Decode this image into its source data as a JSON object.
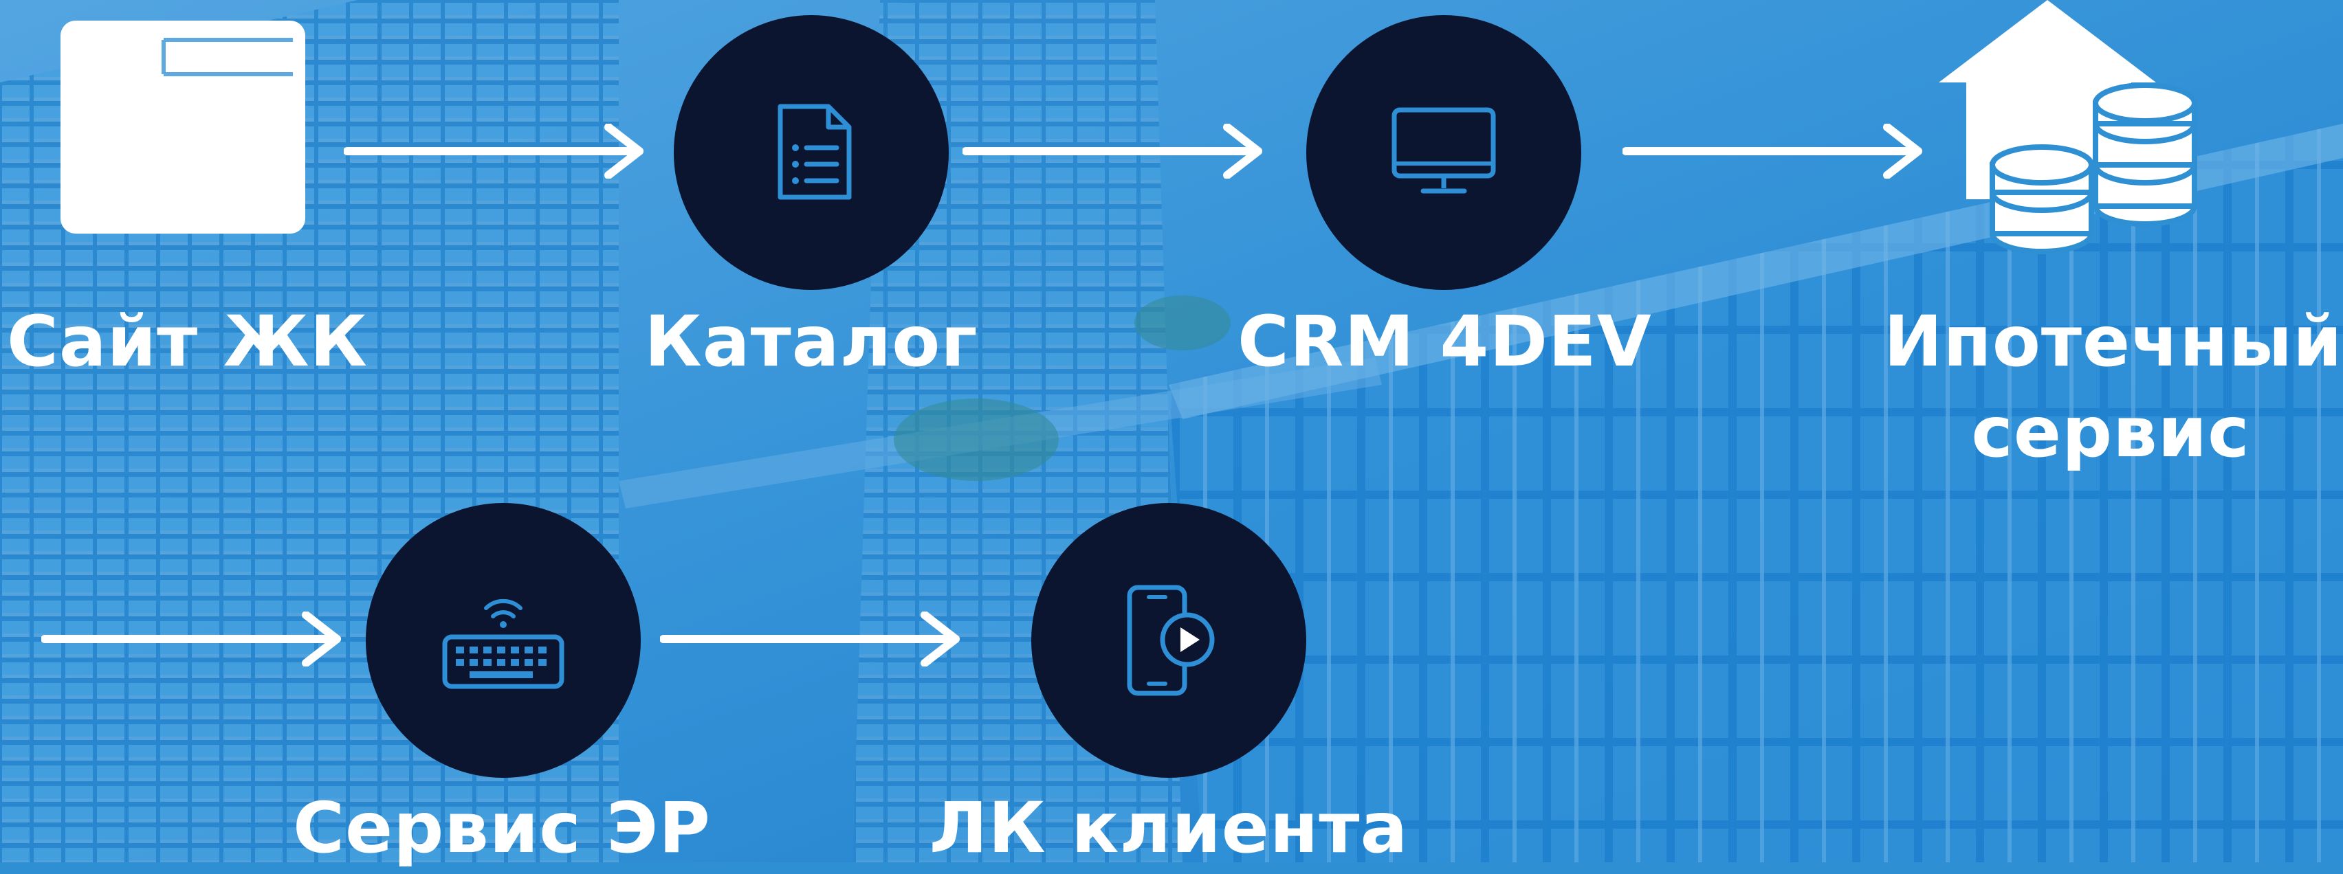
{
  "diagram": {
    "nodes": [
      {
        "id": "site",
        "label": "Сайт ЖК",
        "icon": "browser-window-icon"
      },
      {
        "id": "catalog",
        "label": "Каталог",
        "icon": "document-list-icon"
      },
      {
        "id": "crm",
        "label": "CRM 4DEV",
        "icon": "monitor-icon"
      },
      {
        "id": "mortgage",
        "label_line1": "Ипотечный",
        "label_line2": "сервис",
        "icon": "house-coins-icon"
      },
      {
        "id": "er",
        "label": "Сервис ЭР",
        "icon": "wireless-keyboard-icon"
      },
      {
        "id": "lk",
        "label": "ЛК клиента",
        "icon": "smartphone-play-icon"
      }
    ],
    "edges": [
      {
        "from": "site",
        "to": "catalog"
      },
      {
        "from": "catalog",
        "to": "crm"
      },
      {
        "from": "crm",
        "to": "mortgage"
      },
      {
        "from": "",
        "to": "er"
      },
      {
        "from": "er",
        "to": "lk"
      }
    ]
  },
  "colors": {
    "node_fill": "#0b1530",
    "icon_stroke": "#2e8fd6",
    "arrow": "#ffffff",
    "background": "#2f8fd3"
  }
}
